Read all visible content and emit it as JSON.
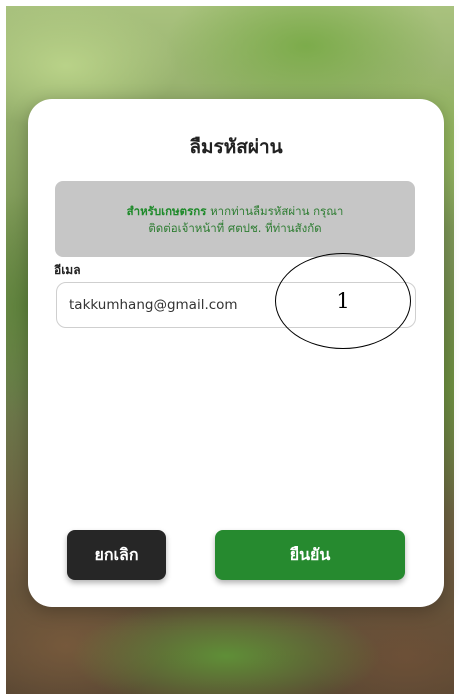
{
  "dialog": {
    "title": "ลืมรหัสผ่าน",
    "notice": {
      "highlight": "สำหรับเกษตรกร",
      "text_line1": " หากท่านลืมรหัสผ่าน กรุณา",
      "text_line2": "ติดต่อเจ้าหน้าที่ ศตปช. ที่ท่านสังกัด"
    },
    "email": {
      "label": "อีเมล",
      "value": "takkumhang@gmail.com"
    },
    "annotation_number": "1",
    "buttons": {
      "cancel": "ยกเลิก",
      "confirm": "ยืนยัน"
    }
  },
  "colors": {
    "confirm_button": "#268a2f",
    "cancel_button": "#262626",
    "notice_background": "#c6c6c6",
    "notice_text": "#2e7d32"
  }
}
